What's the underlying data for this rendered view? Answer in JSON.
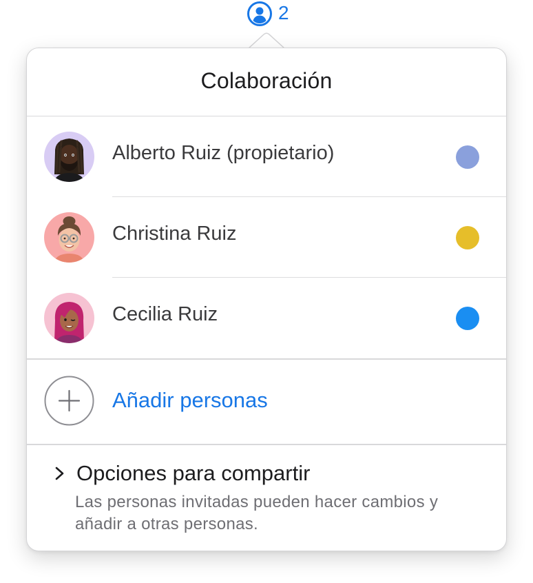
{
  "collaborators_button": {
    "icon": "person-circle-icon",
    "count": "2",
    "accent_color": "#1877e6"
  },
  "popover": {
    "title": "Colaboración",
    "participants": [
      {
        "name": "Alberto Ruiz (propietario)",
        "avatar": "memoji-alberto",
        "avatar_bg": "#d8ccf4",
        "color": "#8aa0dc"
      },
      {
        "name": "Christina Ruiz",
        "avatar": "memoji-christina",
        "avatar_bg": "#f8a8a8",
        "color": "#e6be2a"
      },
      {
        "name": "Cecilia Ruiz",
        "avatar": "memoji-cecilia",
        "avatar_bg": "#f6c2d2",
        "color": "#1a8ef2"
      }
    ],
    "add_people": {
      "label": "Añadir personas",
      "icon": "plus-circle-icon"
    },
    "share_options": {
      "icon": "chevron-right-icon",
      "title": "Opciones para compartir",
      "description": "Las personas invitadas pueden hacer cambios y añadir a otras personas."
    }
  }
}
